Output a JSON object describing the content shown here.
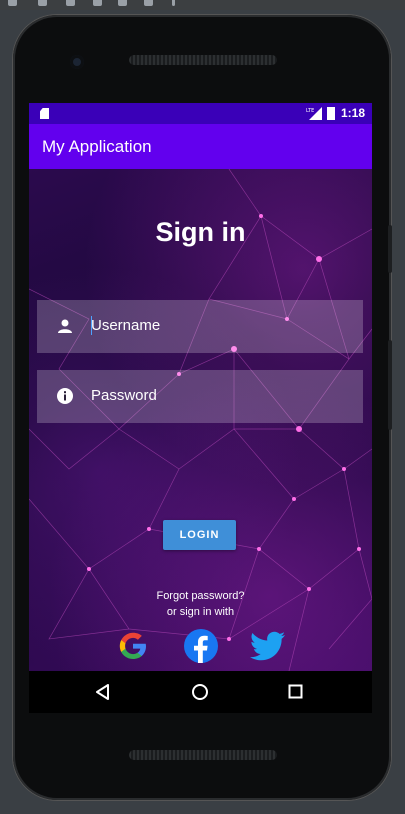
{
  "status_bar": {
    "time": "1:18",
    "icons": [
      "sd-card-icon",
      "lte-signal-icon",
      "battery-charging-icon"
    ]
  },
  "app_bar": {
    "title": "My Application"
  },
  "login_screen": {
    "heading": "Sign in",
    "username_field": {
      "placeholder": "Username",
      "icon": "person-icon"
    },
    "password_field": {
      "placeholder": "Password",
      "icon": "info-icon"
    },
    "login_button": "LOGIN",
    "forgot_password": "Forgot password?",
    "sign_in_with": "or sign in with",
    "social": [
      {
        "name": "google-icon",
        "color": "#4285f4"
      },
      {
        "name": "facebook-icon",
        "color": "#1877f2"
      },
      {
        "name": "twitter-icon",
        "color": "#1da1f2"
      }
    ]
  },
  "nav_bar": {
    "buttons": [
      "back-icon",
      "home-icon",
      "recents-icon"
    ]
  },
  "colors": {
    "status_bar": "#3a00b8",
    "app_bar": "#6200ee",
    "login_button": "#3f8fd8",
    "background": "#1b0838"
  }
}
